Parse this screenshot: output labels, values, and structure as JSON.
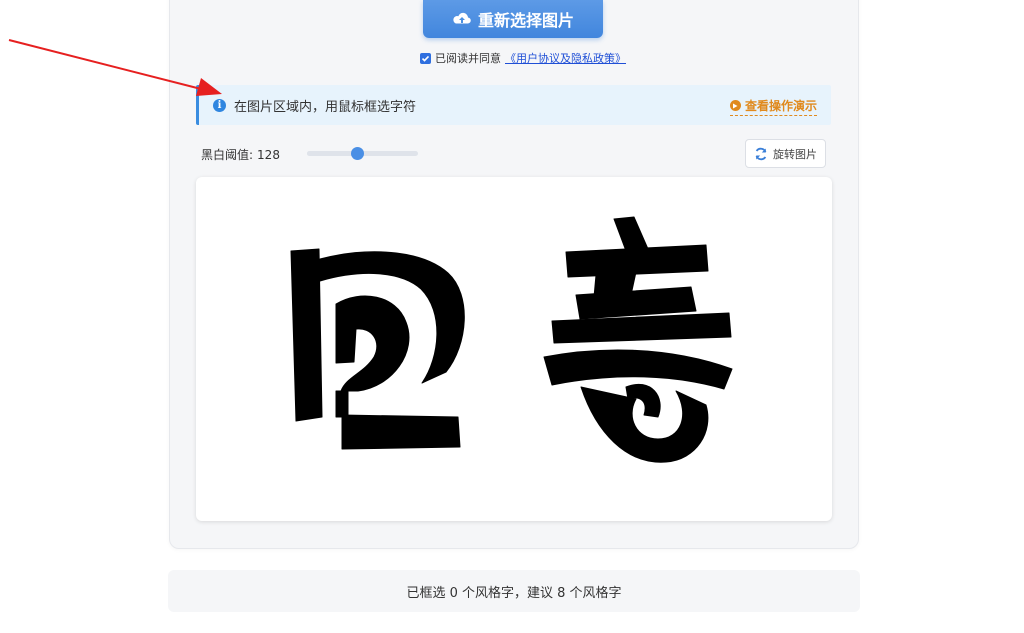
{
  "upload": {
    "label": "重新选择图片",
    "icon": "cloud-upload-icon"
  },
  "agreement": {
    "text": "已阅读并同意",
    "link": "《用户协议及隐私政策》",
    "checked": true
  },
  "info": {
    "icon": "info-icon",
    "text": "在图片区域内，用鼠标框选字符",
    "demo_label": "查看操作演示",
    "demo_icon": "play-icon"
  },
  "threshold": {
    "label": "黑白阈值:",
    "value": "128",
    "fraction": 0.45
  },
  "rotate": {
    "label": "旋转图片",
    "icon": "refresh-icon"
  },
  "status": {
    "text": "已框选 0 个风格字，建议 8 个风格字"
  },
  "colors": {
    "primary": "#4186dd",
    "accent": "#e08a1e",
    "arrow": "#e62020"
  }
}
